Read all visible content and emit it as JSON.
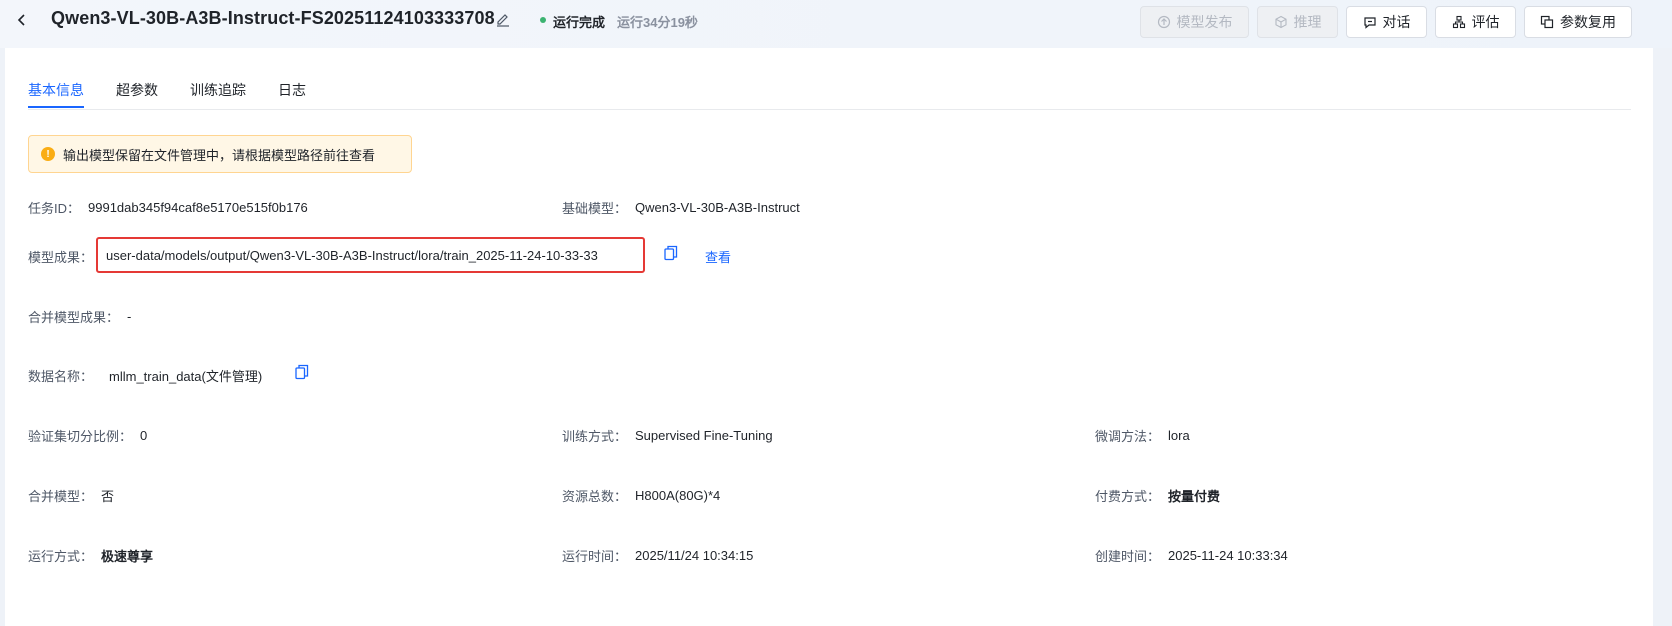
{
  "header": {
    "title": "Qwen3-VL-30B-A3B-Instruct-FS20251124103333708",
    "status": "运行完成",
    "runtime": "运行34分19秒",
    "status_color": "#3cb371",
    "buttons": {
      "publish": "模型发布",
      "inference": "推理",
      "chat": "对话",
      "evaluate": "评估",
      "reuse": "参数复用"
    }
  },
  "tabs": [
    "基本信息",
    "超参数",
    "训练追踪",
    "日志"
  ],
  "notice": "输出模型保留在文件管理中，请根据模型路径前往查看",
  "fields": {
    "task_id": {
      "label": "任务ID：",
      "value": "9991dab345f94caf8e5170e515f0b176"
    },
    "base_model": {
      "label": "基础模型：",
      "value": "Qwen3-VL-30B-A3B-Instruct"
    },
    "model_output": {
      "label": "模型成果：",
      "value": "user-data/models/output/Qwen3-VL-30B-A3B-Instruct/lora/train_2025-11-24-10-33-33",
      "link": "查看"
    },
    "merged_output": {
      "label": "合并模型成果：",
      "value": "-"
    },
    "dataset": {
      "label": "数据名称：",
      "value": "mllm_train_data(文件管理)"
    },
    "val_split": {
      "label": "验证集切分比例：",
      "value": "0"
    },
    "train_method": {
      "label": "训练方式：",
      "value": "Supervised Fine-Tuning"
    },
    "finetune_method": {
      "label": "微调方法：",
      "value": "lora"
    },
    "merge_model": {
      "label": "合并模型：",
      "value": "否"
    },
    "resources": {
      "label": "资源总数：",
      "value": "H800A(80G)*4"
    },
    "billing": {
      "label": "付费方式：",
      "value": "按量付费"
    },
    "run_mode": {
      "label": "运行方式：",
      "value": "极速尊享"
    },
    "run_time": {
      "label": "运行时间：",
      "value": "2025/11/24 10:34:15"
    },
    "created_time": {
      "label": "创建时间：",
      "value": "2025-11-24 10:33:34"
    }
  },
  "accent_color": "#1a66ff",
  "highlight_color": "#e53935"
}
